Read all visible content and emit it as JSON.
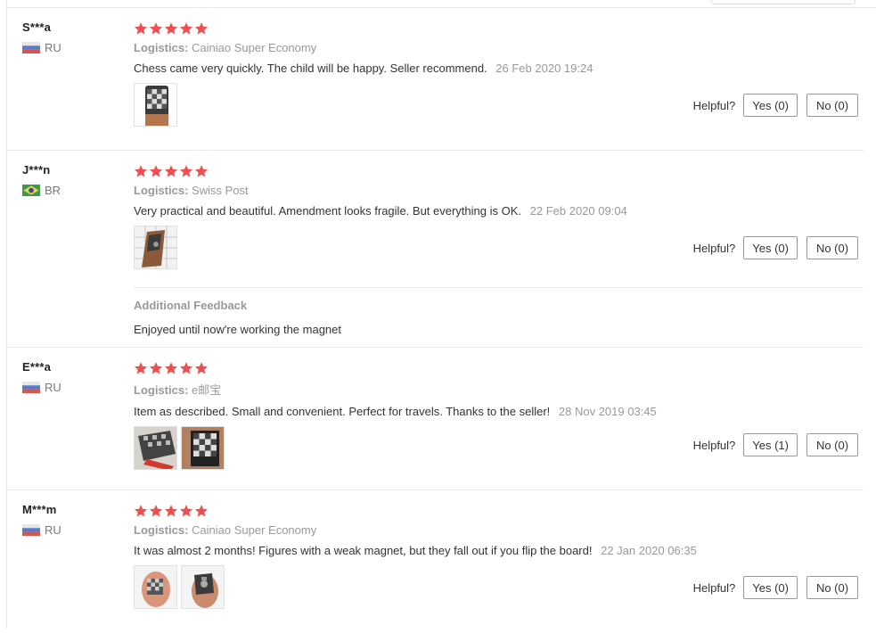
{
  "helpful_label": "Helpful?",
  "colors": {
    "star": "#f04f4f",
    "border": "#e8e8e8",
    "muted": "#999999"
  },
  "reviews": [
    {
      "user": "S***a",
      "country": "RU",
      "flag": "russia-flag-icon",
      "stars": 5,
      "logistics_label": "Logistics:",
      "logistics": "Cainiao Super Economy",
      "text": "Chess came very quickly. The child will be happy. Seller recommend.",
      "date": "26 Feb 2020 19:24",
      "photos": 1,
      "yes": "Yes (0)",
      "no": "No (0)"
    },
    {
      "user": "J***n",
      "country": "BR",
      "flag": "brazil-flag-icon",
      "stars": 5,
      "logistics_label": "Logistics:",
      "logistics": "Swiss Post",
      "text": "Very practical and beautiful. Amendment looks fragile. But everything is OK.",
      "date": "22 Feb 2020 09:04",
      "photos": 1,
      "yes": "Yes (0)",
      "no": "No (0)",
      "additional_title": "Additional Feedback",
      "additional_text": "Enjoyed until now're working the magnet"
    },
    {
      "user": "E***a",
      "country": "RU",
      "flag": "russia-flag-icon",
      "stars": 5,
      "logistics_label": "Logistics:",
      "logistics": "e邮宝",
      "text": "Item as described. Small and convenient. Perfect for travels. Thanks to the seller!",
      "date": "28 Nov 2019 03:45",
      "photos": 2,
      "yes": "Yes (1)",
      "no": "No (0)"
    },
    {
      "user": "M***m",
      "country": "RU",
      "flag": "russia-flag-icon",
      "stars": 5,
      "logistics_label": "Logistics:",
      "logistics": "Cainiao Super Economy",
      "text": "It was almost 2 months! Figures with a weak magnet, but they fall out if you flip the board!",
      "date": "22 Jan 2020 06:35",
      "photos": 2,
      "yes": "Yes (0)",
      "no": "No (0)"
    }
  ]
}
